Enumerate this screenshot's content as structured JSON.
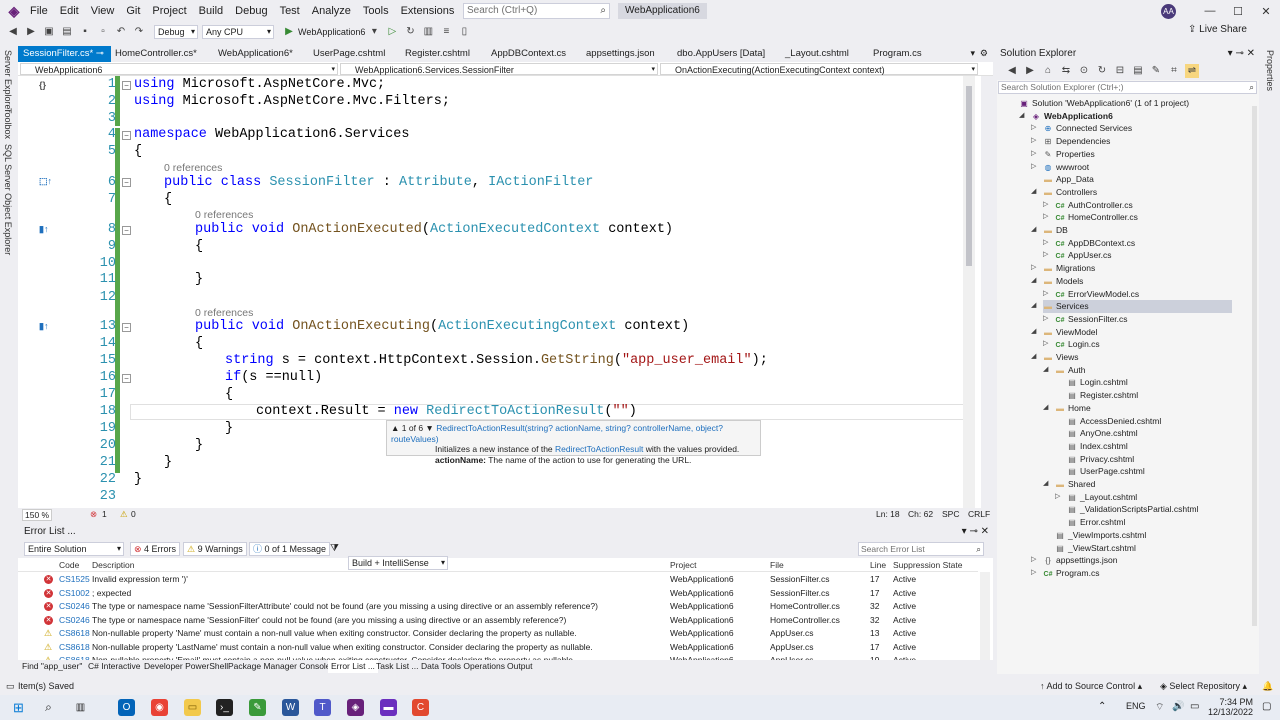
{
  "title_bar": {
    "menus": [
      "File",
      "Edit",
      "View",
      "Git",
      "Project",
      "Build",
      "Debug",
      "Test",
      "Analyze",
      "Tools",
      "Extensions",
      "Window",
      "Help"
    ],
    "search_placeholder": "Search (Ctrl+Q)",
    "solution_name": "WebApplication6",
    "avatar_initials": "AA"
  },
  "toolbar": {
    "config": "Debug",
    "platform": "Any CPU",
    "run_target": "WebApplication6",
    "live_share": "Live Share"
  },
  "left_strip": [
    "Server Explorer",
    "Toolbox",
    "SQL Server Object Explorer"
  ],
  "doc_tabs": [
    "SessionFilter.cs*",
    "HomeController.cs*",
    "WebApplication6*",
    "UserPage.cshtml",
    "Register.cshtml",
    "AppDBContext.cs",
    "appsettings.json",
    "dbo.AppUsers [Data]",
    "_Layout.cshtml",
    "Program.cs"
  ],
  "nav_bar": {
    "project": "WebApplication6",
    "type": "WebApplication6.Services.SessionFilter",
    "member": "OnActionExecuting(ActionExecutingContext context)"
  },
  "code": {
    "references_label": "0 references",
    "lines": [
      "1",
      "2",
      "3",
      "4",
      "5",
      "6",
      "7",
      "8",
      "9",
      "10",
      "11",
      "12",
      "13",
      "14",
      "15",
      "16",
      "17",
      "18",
      "19",
      "20",
      "21",
      "22",
      "23"
    ],
    "l1_kw": "using",
    "l1_rest": " Microsoft.AspNetCore.Mvc;",
    "l2_kw": "using",
    "l2_rest": " Microsoft.AspNetCore.Mvc.Filters;",
    "l4_kw": "namespace",
    "l4_rest": " WebApplication6.Services",
    "open_brace": "{",
    "close_brace": "}",
    "l6_kw": "public class",
    "l6_type": "SessionFilter",
    "l6_colon": " : ",
    "l6_t2": "Attribute",
    "l6_comma": ", ",
    "l6_t3": "IActionFilter",
    "l8_kw": "public void",
    "l8_fn": "OnActionExecuted",
    "l8_paren": "(",
    "l8_t": "ActionExecutedContext",
    "l8_rest": " context)",
    "l13_kw": "public void",
    "l13_fn": "OnActionExecuting",
    "l13_paren": "(",
    "l13_t": "ActionExecutingContext",
    "l13_rest": " context)",
    "l15_kw": "string",
    "l15_a": " s = context.HttpContext.Session.",
    "l15_fn": "GetString",
    "l15_p": "(",
    "l15_str": "\"app_user_email\"",
    "l15_end": ");",
    "l16_kw": "if",
    "l16_rest": "(s ==null)",
    "l18_a": "context.Result = ",
    "l18_kw": "new",
    "l18_sp": " ",
    "l18_t": "RedirectToActionResult",
    "l18_p": "(",
    "l18_str": "\"\"",
    "l18_end": ")"
  },
  "tooltip": {
    "counter": "1 of 6",
    "sig_name": "RedirectToActionResult",
    "sig_params": "(string? actionName, string? controllerName, object? routeValues)",
    "desc_a": "Initializes a new instance of the ",
    "desc_link": "RedirectToActionResult",
    "desc_b": " with the values provided.",
    "param_name": "actionName:",
    "param_desc": " The name of the action to use for generating the URL."
  },
  "editor_status": {
    "zoom": "150 %",
    "errors": "1",
    "warnings": "0",
    "position": "Ln: 18",
    "column": "Ch: 62",
    "spc": "SPC",
    "eol": "CRLF"
  },
  "error_list": {
    "title": "Error List ...",
    "scope": "Entire Solution",
    "errors_btn": "4 Errors",
    "warnings_btn": "9 Warnings",
    "messages_btn": "0 of 1 Message",
    "build_filter": "Build + IntelliSense",
    "search_placeholder": "Search Error List",
    "columns": [
      "Code",
      "Description",
      "Project",
      "File",
      "Line",
      "Suppression State"
    ],
    "rows": [
      {
        "sev": "error",
        "code": "CS1525",
        "desc": "Invalid expression term ')'",
        "project": "WebApplication6",
        "file": "SessionFilter.cs",
        "line": "17",
        "state": "Active"
      },
      {
        "sev": "error",
        "code": "CS1002",
        "desc": "; expected",
        "project": "WebApplication6",
        "file": "SessionFilter.cs",
        "line": "17",
        "state": "Active"
      },
      {
        "sev": "error",
        "code": "CS0246",
        "desc": "The type or namespace name 'SessionFilterAttribute' could not be found (are you missing a using directive or an assembly reference?)",
        "project": "WebApplication6",
        "file": "HomeController.cs",
        "line": "32",
        "state": "Active"
      },
      {
        "sev": "error",
        "code": "CS0246",
        "desc": "The type or namespace name 'SessionFilter' could not be found (are you missing a using directive or an assembly reference?)",
        "project": "WebApplication6",
        "file": "HomeController.cs",
        "line": "32",
        "state": "Active"
      },
      {
        "sev": "warn",
        "code": "CS8618",
        "desc": "Non-nullable property 'Name' must contain a non-null value when exiting constructor. Consider declaring the property as nullable.",
        "project": "WebApplication6",
        "file": "AppUser.cs",
        "line": "13",
        "state": "Active"
      },
      {
        "sev": "warn",
        "code": "CS8618",
        "desc": "Non-nullable property 'LastName' must contain a non-null value when exiting constructor. Consider declaring the property as nullable.",
        "project": "WebApplication6",
        "file": "AppUser.cs",
        "line": "17",
        "state": "Active"
      },
      {
        "sev": "warn",
        "code": "CS8618",
        "desc": "Non-nullable property 'Email' must contain a non-null value when exiting constructor. Consider declaring the property as nullable.",
        "project": "WebApplication6",
        "file": "AppUser.cs",
        "line": "19",
        "state": "Active"
      }
    ]
  },
  "bottom_tabs": [
    "Find \"app_user\"",
    "C# Interactive",
    "Developer PowerShell",
    "Package Manager Console",
    "Error List ...",
    "Task List ...",
    "Data Tools Operations",
    "Output"
  ],
  "solution_explorer": {
    "title": "Solution Explorer",
    "search_placeholder": "Search Solution Explorer (Ctrl+;)",
    "nodes": [
      {
        "label": "Solution 'WebApplication6' (1 of 1 project)",
        "icon": "sln",
        "indent": 0,
        "arrow": ""
      },
      {
        "label": "WebApplication6",
        "icon": "proj",
        "indent": 1,
        "arrow": "down",
        "bold": true
      },
      {
        "label": "Connected Services",
        "icon": "svc",
        "indent": 2,
        "arrow": "right"
      },
      {
        "label": "Dependencies",
        "icon": "dep",
        "indent": 2,
        "arrow": "right"
      },
      {
        "label": "Properties",
        "icon": "prop",
        "indent": 2,
        "arrow": "right"
      },
      {
        "label": "wwwroot",
        "icon": "globe",
        "indent": 2,
        "arrow": "right"
      },
      {
        "label": "App_Data",
        "icon": "folder",
        "indent": 2,
        "arrow": ""
      },
      {
        "label": "Controllers",
        "icon": "folder",
        "indent": 2,
        "arrow": "down"
      },
      {
        "label": "AuthController.cs",
        "icon": "cs",
        "indent": 3,
        "arrow": "right"
      },
      {
        "label": "HomeController.cs",
        "icon": "cs",
        "indent": 3,
        "arrow": "right"
      },
      {
        "label": "DB",
        "icon": "folder",
        "indent": 2,
        "arrow": "down"
      },
      {
        "label": "AppDBContext.cs",
        "icon": "cs",
        "indent": 3,
        "arrow": "right"
      },
      {
        "label": "AppUser.cs",
        "icon": "cs",
        "indent": 3,
        "arrow": "right"
      },
      {
        "label": "Migrations",
        "icon": "folder",
        "indent": 2,
        "arrow": "right"
      },
      {
        "label": "Models",
        "icon": "folder",
        "indent": 2,
        "arrow": "down"
      },
      {
        "label": "ErrorViewModel.cs",
        "icon": "cs",
        "indent": 3,
        "arrow": "right"
      },
      {
        "label": "Services",
        "icon": "folder",
        "indent": 2,
        "arrow": "down",
        "selected": true
      },
      {
        "label": "SessionFilter.cs",
        "icon": "cs",
        "indent": 3,
        "arrow": "right"
      },
      {
        "label": "ViewModel",
        "icon": "folder",
        "indent": 2,
        "arrow": "down"
      },
      {
        "label": "Login.cs",
        "icon": "cs",
        "indent": 3,
        "arrow": "right"
      },
      {
        "label": "Views",
        "icon": "folder",
        "indent": 2,
        "arrow": "down"
      },
      {
        "label": "Auth",
        "icon": "folder",
        "indent": 3,
        "arrow": "down"
      },
      {
        "label": "Login.cshtml",
        "icon": "cshtml",
        "indent": 4,
        "arrow": ""
      },
      {
        "label": "Register.cshtml",
        "icon": "cshtml",
        "indent": 4,
        "arrow": ""
      },
      {
        "label": "Home",
        "icon": "folder",
        "indent": 3,
        "arrow": "down"
      },
      {
        "label": "AccessDenied.cshtml",
        "icon": "cshtml",
        "indent": 4,
        "arrow": ""
      },
      {
        "label": "AnyOne.cshtml",
        "icon": "cshtml",
        "indent": 4,
        "arrow": ""
      },
      {
        "label": "Index.cshtml",
        "icon": "cshtml",
        "indent": 4,
        "arrow": ""
      },
      {
        "label": "Privacy.cshtml",
        "icon": "cshtml",
        "indent": 4,
        "arrow": ""
      },
      {
        "label": "UserPage.cshtml",
        "icon": "cshtml",
        "indent": 4,
        "arrow": ""
      },
      {
        "label": "Shared",
        "icon": "folder",
        "indent": 3,
        "arrow": "down"
      },
      {
        "label": "_Layout.cshtml",
        "icon": "cshtml",
        "indent": 4,
        "arrow": "right"
      },
      {
        "label": "_ValidationScriptsPartial.cshtml",
        "icon": "cshtml",
        "indent": 4,
        "arrow": ""
      },
      {
        "label": "Error.cshtml",
        "icon": "cshtml",
        "indent": 4,
        "arrow": ""
      },
      {
        "label": "_ViewImports.cshtml",
        "icon": "cshtml",
        "indent": 3,
        "arrow": ""
      },
      {
        "label": "_ViewStart.cshtml",
        "icon": "cshtml",
        "indent": 3,
        "arrow": ""
      },
      {
        "label": "appsettings.json",
        "icon": "json",
        "indent": 2,
        "arrow": "right"
      },
      {
        "label": "Program.cs",
        "icon": "cs",
        "indent": 2,
        "arrow": "right"
      }
    ]
  },
  "right_strip": "Properties",
  "status_bar": {
    "message": "Item(s) Saved",
    "add_source": "Add to Source Control",
    "select_repo": "Select Repository"
  },
  "taskbar": {
    "lang": "ENG",
    "time": "7:34 PM",
    "date": "12/13/2022"
  },
  "colors": {
    "accent": "#007acc",
    "brand": "#68217a",
    "error": "#d13438",
    "warning": "#c8a000"
  }
}
